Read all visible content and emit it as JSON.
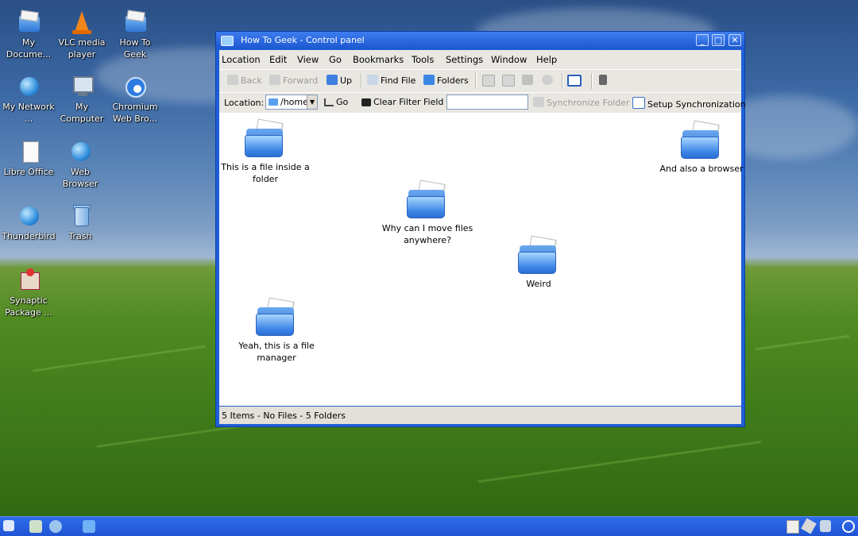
{
  "desktop": {
    "icons": [
      {
        "label": "My Docume..."
      },
      {
        "label": "VLC media player"
      },
      {
        "label": "How To Geek"
      },
      {
        "label": "My Network ..."
      },
      {
        "label": "My Computer"
      },
      {
        "label": "Chromium Web Bro..."
      },
      {
        "label": "Libre Office"
      },
      {
        "label": "Web Browser"
      },
      {
        "label": "Thunderbird"
      },
      {
        "label": "Trash"
      },
      {
        "label": "Synaptic Package ..."
      }
    ]
  },
  "window": {
    "title": "How To Geek - Control panel",
    "controls": {
      "minimize": "_",
      "maximize": "□",
      "close": "✕"
    },
    "menu": [
      "Location",
      "Edit",
      "View",
      "Go",
      "Bookmarks",
      "Tools",
      "Settings",
      "Window",
      "Help"
    ],
    "toolbar": {
      "back": "Back",
      "forward": "Forward",
      "up": "Up",
      "find_file": "Find File",
      "folders": "Folders"
    },
    "locationbar": {
      "label": "Location:",
      "path": "/home",
      "go": "Go",
      "clear_filter": "Clear Filter Field",
      "filter_value": "",
      "synchronize": "Synchronize Folder",
      "setup_sync": "Setup Synchronization"
    },
    "items": [
      {
        "label": "This is a file inside a folder"
      },
      {
        "label": "And also a browser"
      },
      {
        "label": "Why can I move files anywhere?"
      },
      {
        "label": "Weird"
      },
      {
        "label": "Yeah, this is a file manager"
      }
    ],
    "status": "5 Items - No Files - 5 Folders"
  }
}
